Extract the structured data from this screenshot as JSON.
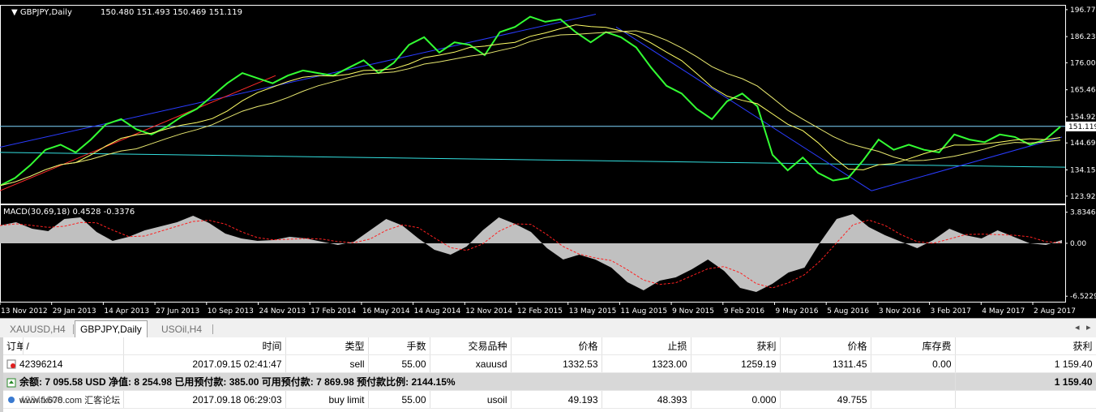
{
  "chart": {
    "symbol_label": "GBPJPY,Daily",
    "ohlc": "150.480 151.493 150.469 151.119",
    "price_levels": [
      "196.770",
      "186.235",
      "176.000",
      "165.465",
      "154.920",
      "151.119",
      "144.690",
      "134.150",
      "123.920"
    ],
    "current_price": "151.119",
    "macd_label": "MACD(30,69,18) 0.4528 -0.3376",
    "macd_levels": [
      "3.8346",
      "0.00",
      "-6.5229"
    ],
    "dates": [
      "13 Nov 2012",
      "29 Jan 2013",
      "14 Apr 2013",
      "27 Jun 2013",
      "10 Sep 2013",
      "24 Nov 2013",
      "17 Feb 2014",
      "16 May 2014",
      "14 Aug 2014",
      "12 Nov 2014",
      "12 Feb 2015",
      "13 May 2015",
      "11 Aug 2015",
      "9 Nov 2015",
      "9 Feb 2016",
      "9 May 2016",
      "5 Aug 2016",
      "3 Nov 2016",
      "3 Feb 2017",
      "4 May 2017",
      "2 Aug 2017"
    ],
    "price_series": [
      128,
      131,
      136,
      142,
      144,
      141,
      146,
      152,
      154,
      150,
      148,
      151,
      155,
      158,
      163,
      168,
      172,
      170,
      168,
      171,
      173,
      172,
      171,
      174,
      177,
      172,
      176,
      183,
      186,
      180,
      184,
      183,
      179,
      188,
      190,
      194,
      192,
      193,
      188,
      184,
      188,
      186,
      182,
      174,
      167,
      164,
      158,
      154,
      161,
      164,
      159,
      140,
      134,
      139,
      133,
      130,
      131,
      138,
      146,
      142,
      144,
      142,
      141,
      148,
      146,
      145,
      148,
      147,
      144,
      146,
      151
    ],
    "macd_series": [
      2.2,
      2.6,
      1.8,
      1.5,
      3.0,
      3.2,
      1.4,
      0.3,
      0.8,
      1.6,
      2.1,
      2.6,
      3.4,
      2.5,
      1.2,
      0.6,
      0.3,
      0.4,
      0.8,
      0.6,
      0.2,
      -0.2,
      0.2,
      1.6,
      3.0,
      2.2,
      0.6,
      -0.8,
      -1.4,
      -0.4,
      1.6,
      3.2,
      2.4,
      1.4,
      -0.6,
      -2.0,
      -1.4,
      -2.0,
      -3.0,
      -4.8,
      -5.8,
      -4.6,
      -4.2,
      -3.2,
      -2.0,
      -3.4,
      -5.5,
      -6.0,
      -5.0,
      -3.6,
      -3.0,
      0.2,
      3.0,
      3.6,
      2.0,
      1.0,
      0.2,
      -0.6,
      0.4,
      1.8,
      1.0,
      0.6,
      1.6,
      0.8,
      0.0,
      -0.2,
      0.4
    ]
  },
  "tabs": [
    {
      "label": "XAUUSD,H4",
      "active": false
    },
    {
      "label": "GBPJPY,Daily",
      "active": true
    },
    {
      "label": "USOil,H4",
      "active": false
    }
  ],
  "terminal": {
    "headers": [
      "订单",
      "/",
      "时间",
      "类型",
      "手数",
      "交易品种",
      "价格",
      "止损",
      "获利",
      "价格",
      "库存费",
      "获利"
    ],
    "rows": [
      {
        "order": "42396214",
        "time": "2017.09.15 02:41:47",
        "type": "sell",
        "lots": "55.00",
        "symbol": "xauusd",
        "price": "1332.53",
        "sl": "1323.00",
        "tp": "1259.19",
        "cur_price": "1311.45",
        "swap": "0.00",
        "profit": "1 159.40"
      }
    ],
    "summary": {
      "text": "余额: 7 095.58 USD  净值: 8 254.98  已用预付款: 385.00  可用预付款: 7 869.98  预付款比例: 2144.15%",
      "profit": "1 159.40"
    },
    "pending": {
      "order": "42341600",
      "watermark": "www.fx678.com 汇客论坛",
      "time": "2017.09.18 06:29:03",
      "type": "buy limit",
      "lots": "55.00",
      "symbol": "usoil",
      "price": "49.193",
      "sl": "48.393",
      "tp": "0.000",
      "cur_price": "49.755",
      "swap": "",
      "profit": ""
    }
  },
  "colors": {
    "price_line": "#33ff33",
    "ma_yellow": "#ffff66",
    "trend_blue": "#2a3cff",
    "trend_red": "#ff2a2a",
    "level_cyan": "#7fd6ff",
    "macd_fill": "#c0c0c0",
    "macd_signal": "#ff2020"
  }
}
